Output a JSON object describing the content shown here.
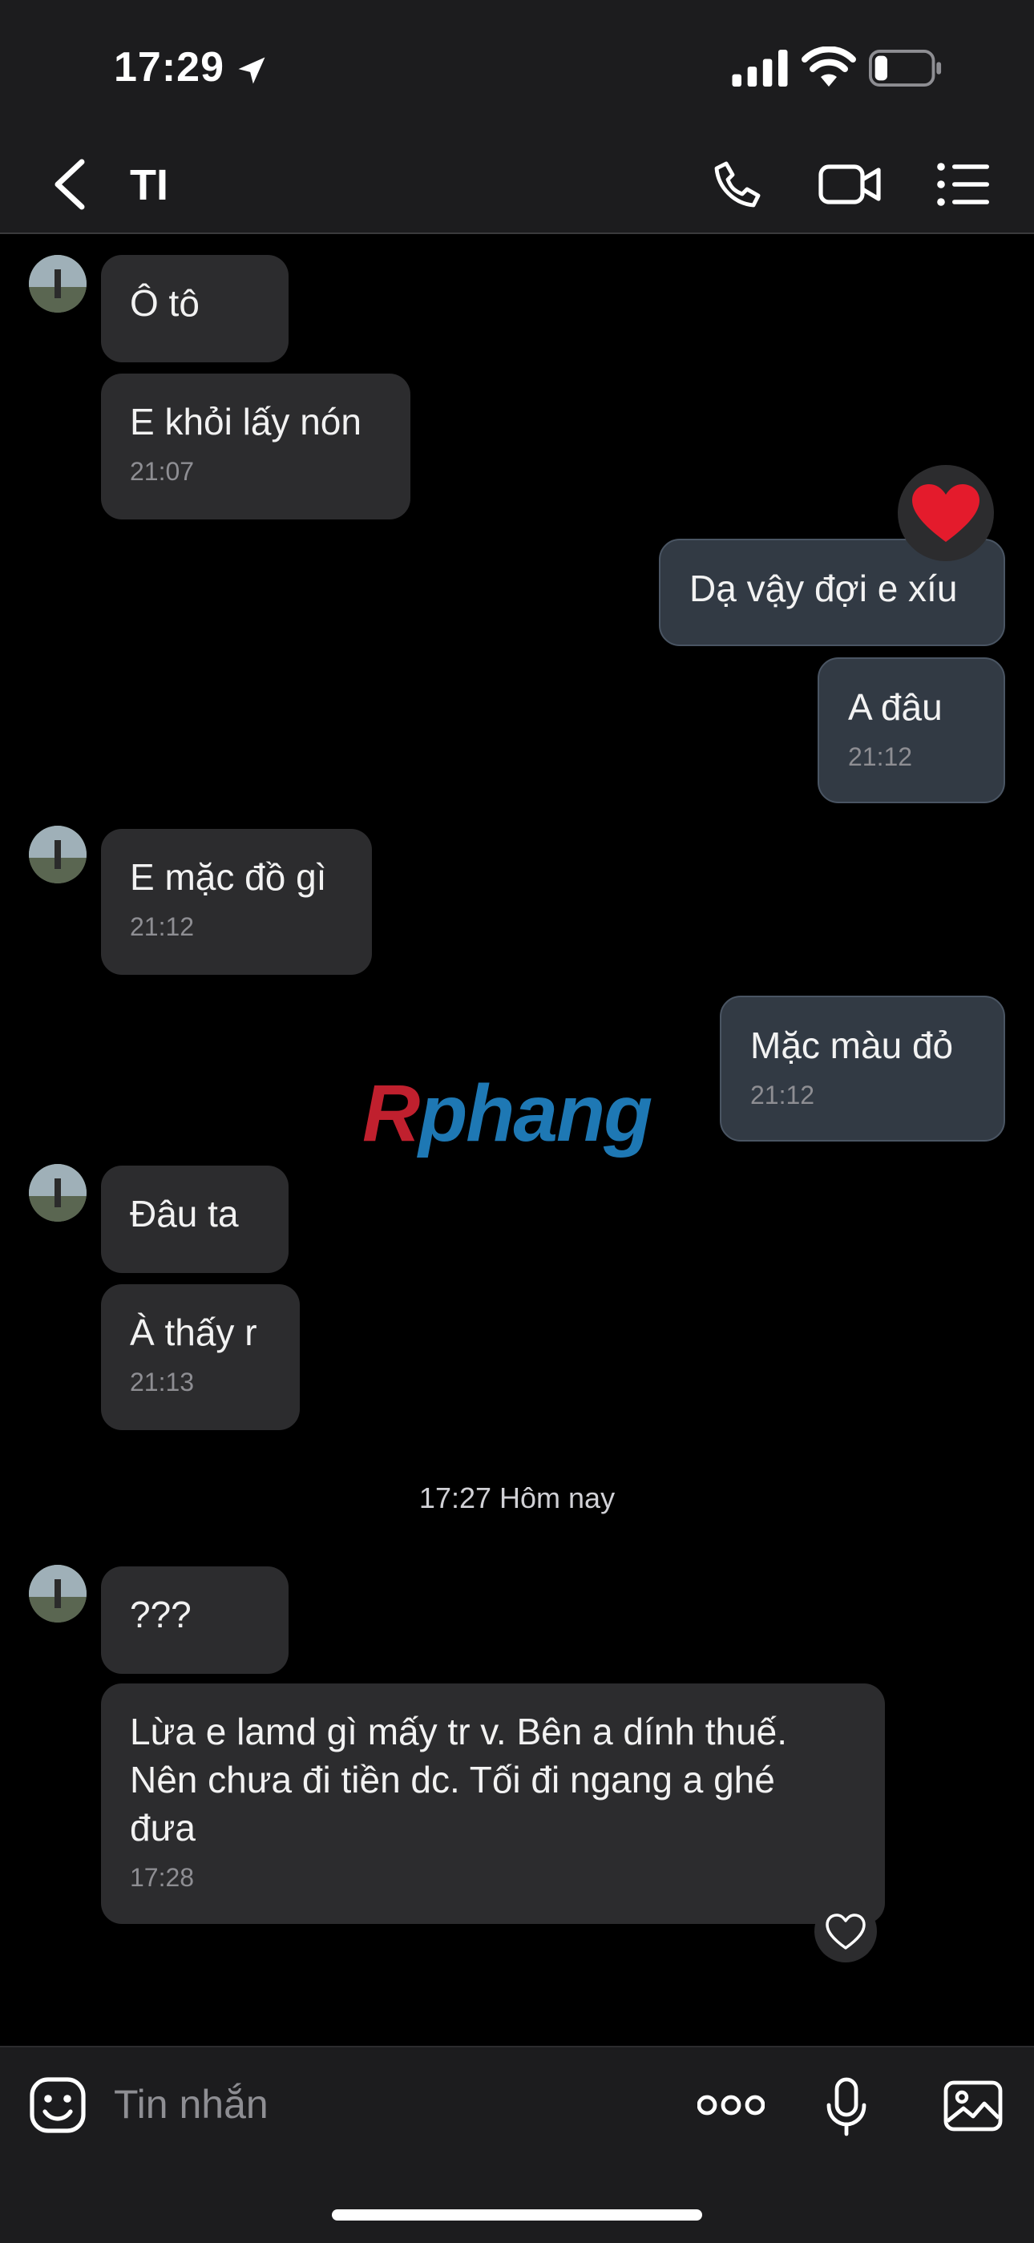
{
  "status": {
    "time": "17:29"
  },
  "header": {
    "title": "TI"
  },
  "messages": [
    {
      "text": "Ô tô",
      "time": ""
    },
    {
      "text": "E khỏi lấy nón",
      "time": "21:07"
    },
    {
      "text": "Dạ vậy đợi e xíu",
      "time": ""
    },
    {
      "text": "A đâu",
      "time": "21:12"
    },
    {
      "text": "E mặc đồ gì",
      "time": "21:12"
    },
    {
      "text": "Mặc màu đỏ",
      "time": "21:12"
    },
    {
      "text": "Đâu ta",
      "time": ""
    },
    {
      "text": "À thấy r",
      "time": "21:13"
    },
    {
      "text": "???",
      "time": ""
    },
    {
      "text": "Lừa e lamd gì mấy tr v. Bên a dính thuế.\nNên chưa đi tiền dc. Tối đi ngang a ghé\nđưa",
      "time": "17:28"
    }
  ],
  "day_separator": "17:27 Hôm nay",
  "watermark": {
    "first": "R",
    "rest": "phang"
  },
  "composer": {
    "placeholder": "Tin nhắn"
  },
  "icons": [
    "location-arrow-icon",
    "signal-icon",
    "wifi-icon",
    "battery-icon",
    "back-icon",
    "phone-icon",
    "video-call-icon",
    "menu-icon",
    "heart-reaction-icon",
    "heart-outline-icon",
    "emoji-icon",
    "more-dots-icon",
    "microphone-icon",
    "image-icon"
  ],
  "colors": {
    "incoming_bubble": "#2c2c2e",
    "outgoing_bubble": "#323a44",
    "background": "#000000",
    "bar": "#1c1c1e"
  }
}
